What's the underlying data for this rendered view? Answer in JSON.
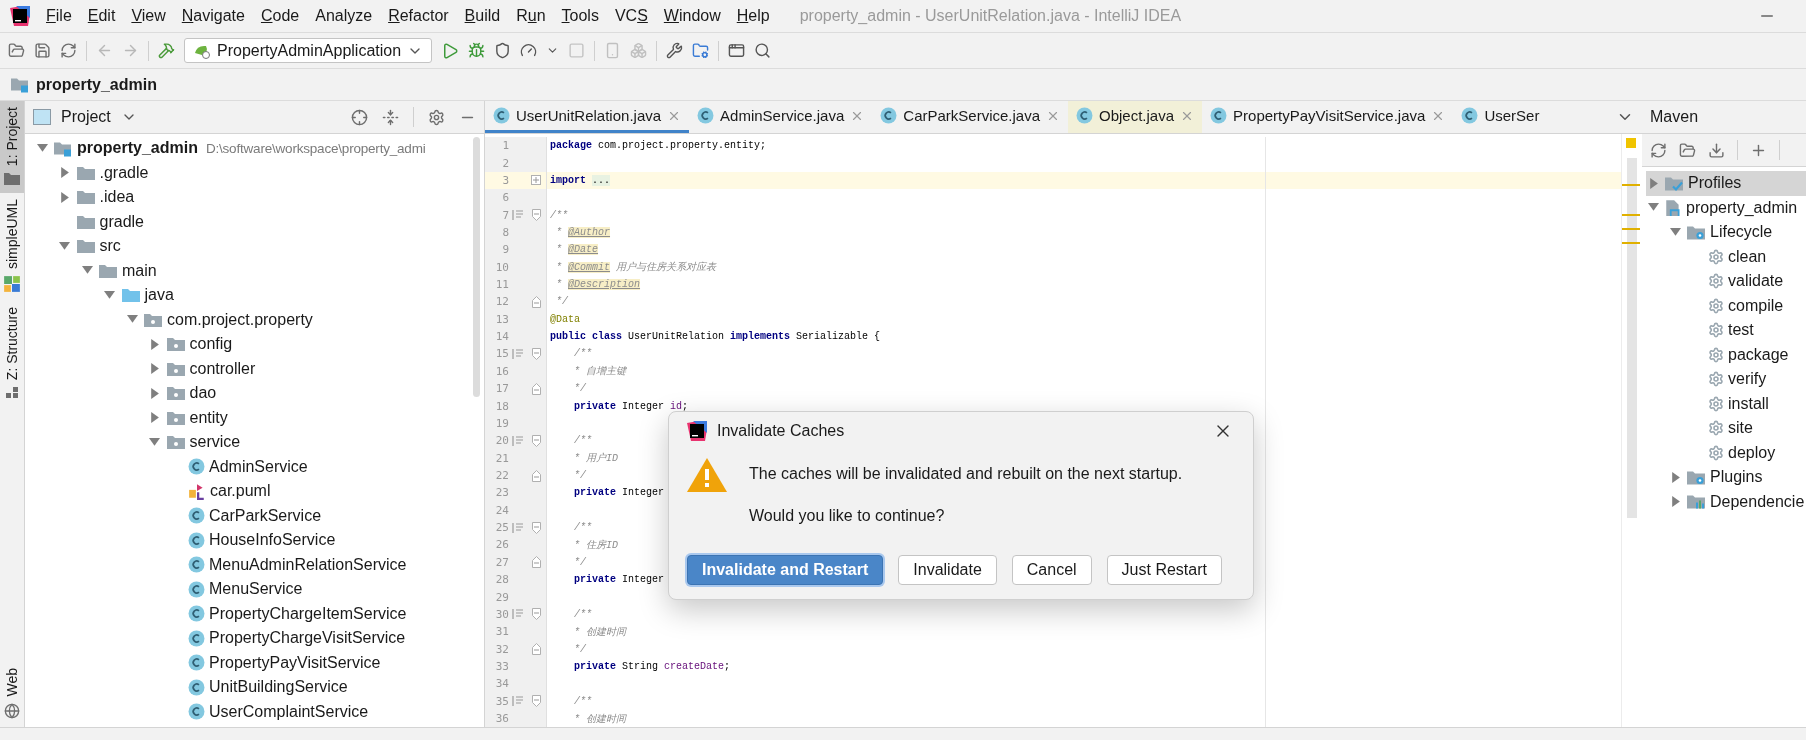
{
  "window": {
    "title": "property_admin - UserUnitRelation.java - IntelliJ IDEA"
  },
  "menu": [
    [
      {
        "text": "F",
        "underlined": true
      },
      {
        "text": "ile",
        "underlined": false
      }
    ],
    [
      {
        "text": "E",
        "underlined": true
      },
      {
        "text": "dit",
        "underlined": false
      }
    ],
    [
      {
        "text": "V",
        "underlined": true
      },
      {
        "text": "iew",
        "underlined": false
      }
    ],
    [
      {
        "text": "N",
        "underlined": true
      },
      {
        "text": "avigate",
        "underlined": false
      }
    ],
    [
      {
        "text": "C",
        "underlined": true
      },
      {
        "text": "ode",
        "underlined": false
      }
    ],
    [
      {
        "text": "Analyze",
        "underlined": false
      }
    ],
    [
      {
        "text": "R",
        "underlined": true
      },
      {
        "text": "efactor",
        "underlined": false
      }
    ],
    [
      {
        "text": "B",
        "underlined": true
      },
      {
        "text": "uild",
        "underlined": false
      }
    ],
    [
      {
        "text": "R",
        "underlined": false
      },
      {
        "text": "u",
        "underlined": true
      },
      {
        "text": "n",
        "underlined": false
      }
    ],
    [
      {
        "text": "T",
        "underlined": true
      },
      {
        "text": "ools",
        "underlined": false
      }
    ],
    [
      {
        "text": "VC",
        "underlined": false
      },
      {
        "text": "S",
        "underlined": true
      }
    ],
    [
      {
        "text": "W",
        "underlined": true
      },
      {
        "text": "indow",
        "underlined": false
      }
    ],
    [
      {
        "text": "H",
        "underlined": true
      },
      {
        "text": "elp",
        "underlined": false
      }
    ]
  ],
  "toolbar": {
    "run_config": "PropertyAdminApplication"
  },
  "navigation": {
    "crumb": "property_admin"
  },
  "side_stripe_top": [
    {
      "label": "1: Project",
      "kind": "project",
      "selected": true
    },
    {
      "label": "simpleUML",
      "kind": "uml",
      "selected": false
    },
    {
      "label": "Z: Structure",
      "kind": "structure",
      "selected": false
    }
  ],
  "side_stripe_bottom": [
    {
      "label": "Web",
      "kind": "web",
      "selected": false
    }
  ],
  "project_panel": {
    "title": "Project",
    "tree": [
      {
        "label": "property_admin",
        "path": "D:\\software\\workspace\\property_admi",
        "kind": "module",
        "expanded": true,
        "children": [
          {
            "label": ".gradle",
            "kind": "folder",
            "expanded": false
          },
          {
            "label": ".idea",
            "kind": "folder",
            "expanded": false
          },
          {
            "label": "gradle",
            "kind": "folder"
          },
          {
            "label": "src",
            "kind": "folder",
            "expanded": true,
            "children": [
              {
                "label": "main",
                "kind": "folder",
                "expanded": true,
                "children": [
                  {
                    "label": "java",
                    "kind": "source-root",
                    "expanded": true,
                    "children": [
                      {
                        "label": "com.project.property",
                        "kind": "package",
                        "expanded": true,
                        "children": [
                          {
                            "label": "config",
                            "kind": "package",
                            "expanded": false
                          },
                          {
                            "label": "controller",
                            "kind": "package",
                            "expanded": false
                          },
                          {
                            "label": "dao",
                            "kind": "package",
                            "expanded": false
                          },
                          {
                            "label": "entity",
                            "kind": "package",
                            "expanded": false
                          },
                          {
                            "label": "service",
                            "kind": "package",
                            "expanded": true,
                            "children": [
                              {
                                "label": "AdminService",
                                "kind": "class"
                              },
                              {
                                "label": "car.puml",
                                "kind": "puml"
                              },
                              {
                                "label": "CarParkService",
                                "kind": "class"
                              },
                              {
                                "label": "HouseInfoService",
                                "kind": "class"
                              },
                              {
                                "label": "MenuAdminRelationService",
                                "kind": "class"
                              },
                              {
                                "label": "MenuService",
                                "kind": "class"
                              },
                              {
                                "label": "PropertyChargeItemService",
                                "kind": "class"
                              },
                              {
                                "label": "PropertyChargeVisitService",
                                "kind": "class"
                              },
                              {
                                "label": "PropertyPayVisitService",
                                "kind": "class"
                              },
                              {
                                "label": "UnitBuildingService",
                                "kind": "class"
                              },
                              {
                                "label": "UserComplaintService",
                                "kind": "class"
                              }
                            ]
                          }
                        ]
                      }
                    ]
                  }
                ]
              }
            ]
          }
        ]
      }
    ]
  },
  "editor": {
    "tabs": [
      {
        "label": "UserUnitRelation.java",
        "kind": "source",
        "selected": true,
        "closable": true
      },
      {
        "label": "AdminService.java",
        "kind": "source",
        "selected": false,
        "closable": true
      },
      {
        "label": "CarParkService.java",
        "kind": "source",
        "selected": false,
        "closable": true
      },
      {
        "label": "Object.java",
        "kind": "library",
        "selected": false,
        "closable": true
      },
      {
        "label": "PropertyPayVisitService.java",
        "kind": "source",
        "selected": false,
        "closable": true
      },
      {
        "label": "UserSer",
        "kind": "source",
        "selected": false,
        "closable": false
      }
    ],
    "lines": [
      {
        "n": "1",
        "kind": "plain",
        "current": false,
        "code": [
          {
            "kind": "keyword",
            "text": "package"
          },
          {
            "kind": "plain",
            "text": " com.project.property.entity;"
          }
        ]
      },
      {
        "n": "2",
        "kind": "plain",
        "current": false
      },
      {
        "n": "3",
        "kind": "collapsed",
        "current": true,
        "code": [
          {
            "kind": "keyword",
            "text": "import"
          },
          {
            "kind": "folded",
            "text": "..."
          }
        ]
      },
      {
        "n": "6",
        "kind": "plain",
        "current": false
      },
      {
        "n": "7",
        "kind": "doc-start",
        "current": false,
        "code": [
          {
            "kind": "comment",
            "text": "/**"
          }
        ]
      },
      {
        "n": "8",
        "kind": "plain",
        "current": false,
        "code": [
          {
            "kind": "comment",
            "text": " * "
          },
          {
            "kind": "doc-tag",
            "text": "@Author"
          }
        ]
      },
      {
        "n": "9",
        "kind": "plain",
        "current": false,
        "code": [
          {
            "kind": "comment",
            "text": " * "
          },
          {
            "kind": "doc-tag",
            "text": "@Date"
          }
        ]
      },
      {
        "n": "10",
        "kind": "plain",
        "current": false,
        "code": [
          {
            "kind": "comment",
            "text": " * "
          },
          {
            "kind": "doc-tag",
            "text": "@Commit"
          },
          {
            "kind": "comment",
            "text": " 用户与住房关系对应表"
          }
        ]
      },
      {
        "n": "11",
        "kind": "plain",
        "current": false,
        "code": [
          {
            "kind": "comment",
            "text": " * "
          },
          {
            "kind": "doc-tag",
            "text": "@Description"
          }
        ]
      },
      {
        "n": "12",
        "kind": "fold-end",
        "current": false,
        "code": [
          {
            "kind": "comment",
            "text": " */"
          }
        ]
      },
      {
        "n": "13",
        "kind": "plain",
        "current": false,
        "code": [
          {
            "kind": "annotation",
            "text": "@Data"
          }
        ]
      },
      {
        "n": "14",
        "kind": "plain",
        "current": false,
        "code": [
          {
            "kind": "keyword",
            "text": "public class"
          },
          {
            "kind": "plain",
            "text": " UserUnitRelation "
          },
          {
            "kind": "keyword",
            "text": "implements"
          },
          {
            "kind": "plain",
            "text": " Serializable {"
          }
        ]
      },
      {
        "n": "15",
        "kind": "doc-start",
        "current": false,
        "indented": true,
        "code": [
          {
            "kind": "comment",
            "text": "/**"
          }
        ]
      },
      {
        "n": "16",
        "kind": "plain",
        "current": false,
        "indented": true,
        "code": [
          {
            "kind": "comment",
            "text": "* 自增主键"
          }
        ]
      },
      {
        "n": "17",
        "kind": "fold-end",
        "current": false,
        "indented": true,
        "code": [
          {
            "kind": "comment",
            "text": "*/"
          }
        ]
      },
      {
        "n": "18",
        "kind": "plain",
        "current": false,
        "indented": true,
        "code": [
          {
            "kind": "keyword",
            "text": "private"
          },
          {
            "kind": "plain",
            "text": " Integer "
          },
          {
            "kind": "field",
            "text": "id"
          },
          {
            "kind": "plain",
            "text": ";"
          }
        ]
      },
      {
        "n": "19",
        "kind": "plain",
        "current": false
      },
      {
        "n": "20",
        "kind": "doc-start",
        "current": false,
        "indented": true,
        "code": [
          {
            "kind": "comment",
            "text": "/**"
          }
        ]
      },
      {
        "n": "21",
        "kind": "plain",
        "current": false,
        "indented": true,
        "code": [
          {
            "kind": "comment",
            "text": "* 用户ID"
          }
        ]
      },
      {
        "n": "22",
        "kind": "fold-end",
        "current": false,
        "indented": true,
        "code": [
          {
            "kind": "comment",
            "text": "*/"
          }
        ]
      },
      {
        "n": "23",
        "kind": "plain",
        "current": false,
        "indented": true,
        "code": [
          {
            "kind": "keyword",
            "text": "private"
          },
          {
            "kind": "plain",
            "text": " Integer"
          }
        ]
      },
      {
        "n": "24",
        "kind": "plain",
        "current": false
      },
      {
        "n": "25",
        "kind": "doc-start",
        "current": false,
        "indented": true,
        "code": [
          {
            "kind": "comment",
            "text": "/**"
          }
        ]
      },
      {
        "n": "26",
        "kind": "plain",
        "current": false,
        "indented": true,
        "code": [
          {
            "kind": "comment",
            "text": "* 住房ID"
          }
        ]
      },
      {
        "n": "27",
        "kind": "fold-end",
        "current": false,
        "indented": true,
        "code": [
          {
            "kind": "comment",
            "text": "*/"
          }
        ]
      },
      {
        "n": "28",
        "kind": "plain",
        "current": false,
        "indented": true,
        "code": [
          {
            "kind": "keyword",
            "text": "private"
          },
          {
            "kind": "plain",
            "text": " Integer"
          }
        ]
      },
      {
        "n": "29",
        "kind": "plain",
        "current": false
      },
      {
        "n": "30",
        "kind": "doc-start",
        "current": false,
        "indented": true,
        "code": [
          {
            "kind": "comment",
            "text": "/**"
          }
        ]
      },
      {
        "n": "31",
        "kind": "plain",
        "current": false,
        "indented": true,
        "code": [
          {
            "kind": "comment",
            "text": "* 创建时间"
          }
        ]
      },
      {
        "n": "32",
        "kind": "fold-end",
        "current": false,
        "indented": true,
        "code": [
          {
            "kind": "comment",
            "text": "*/"
          }
        ]
      },
      {
        "n": "33",
        "kind": "plain",
        "current": false,
        "indented": true,
        "code": [
          {
            "kind": "keyword",
            "text": "private"
          },
          {
            "kind": "plain",
            "text": " String "
          },
          {
            "kind": "field",
            "text": "createDate"
          },
          {
            "kind": "plain",
            "text": ";"
          }
        ]
      },
      {
        "n": "34",
        "kind": "plain",
        "current": false
      },
      {
        "n": "35",
        "kind": "doc-start",
        "current": false,
        "indented": true,
        "code": [
          {
            "kind": "comment",
            "text": "/**"
          }
        ]
      },
      {
        "n": "36",
        "kind": "plain",
        "current": false,
        "indented": true,
        "code": [
          {
            "kind": "comment",
            "text": "* 创建时间"
          }
        ]
      }
    ]
  },
  "maven": {
    "title": "Maven",
    "tree": [
      {
        "label": "Profiles",
        "kind": "profiles",
        "expanded": false,
        "selected": true
      },
      {
        "label": "property_admin",
        "kind": "module",
        "expanded": true,
        "selected": false,
        "children": [
          {
            "label": "Lifecycle",
            "kind": "lifecycle",
            "expanded": true,
            "selected": false,
            "children": [
              {
                "label": "clean",
                "kind": "goal",
                "selected": false
              },
              {
                "label": "validate",
                "kind": "goal",
                "selected": false
              },
              {
                "label": "compile",
                "kind": "goal",
                "selected": false
              },
              {
                "label": "test",
                "kind": "goal",
                "selected": false
              },
              {
                "label": "package",
                "kind": "goal",
                "selected": false
              },
              {
                "label": "verify",
                "kind": "goal",
                "selected": false
              },
              {
                "label": "install",
                "kind": "goal",
                "selected": false
              },
              {
                "label": "site",
                "kind": "goal",
                "selected": false
              },
              {
                "label": "deploy",
                "kind": "goal",
                "selected": false
              }
            ]
          },
          {
            "label": "Plugins",
            "kind": "plugins",
            "expanded": false,
            "selected": false
          },
          {
            "label": "Dependencie",
            "kind": "dependencies",
            "expanded": false,
            "selected": false
          }
        ]
      }
    ]
  },
  "dialog": {
    "title": "Invalidate Caches",
    "message": "The caches will be invalidated and rebuilt on the next startup.",
    "question": "Would you like to continue?",
    "buttons": [
      {
        "label": "Invalidate and Restart",
        "default": true
      },
      {
        "label": "Invalidate",
        "default": false
      },
      {
        "label": "Cancel",
        "default": false
      },
      {
        "label": "Just Restart",
        "default": false
      }
    ]
  }
}
